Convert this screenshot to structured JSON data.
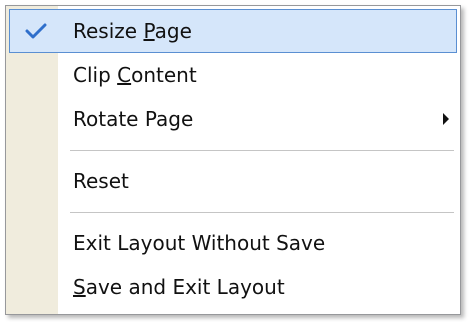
{
  "menu": {
    "items": [
      {
        "pre": "Resize ",
        "mnemonic": "P",
        "post": "age",
        "checked": true,
        "icon": "checkmark-icon"
      },
      {
        "pre": "Clip ",
        "mnemonic": "C",
        "post": "ontent"
      },
      {
        "pre": "Rotate Page",
        "mnemonic": "",
        "post": "",
        "submenu_icon": "submenu-arrow-icon"
      },
      {
        "pre": "Reset",
        "mnemonic": "",
        "post": ""
      },
      {
        "pre": "Exit Layout Without Save",
        "mnemonic": "",
        "post": ""
      },
      {
        "pre": "",
        "mnemonic": "S",
        "post": "ave and Exit Layout"
      }
    ]
  },
  "colors": {
    "gutter": "#f0ecdd",
    "selected_bg": "#d5e6fa",
    "selected_border": "#5a8fd2",
    "check": "#2f6fcb"
  }
}
